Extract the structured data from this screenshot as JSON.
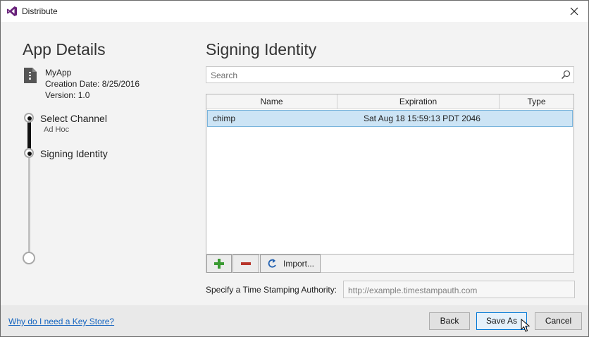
{
  "window": {
    "title": "Distribute",
    "app_icon": "visual-studio-icon",
    "close_icon": "close-icon"
  },
  "left": {
    "section_title": "App Details",
    "app_name": "MyApp",
    "creation_date": "Creation Date: 8/25/2016",
    "version": "Version: 1.0",
    "steps": [
      {
        "label": "Select Channel",
        "sublabel": "Ad Hoc"
      },
      {
        "label": "Signing Identity",
        "sublabel": ""
      }
    ]
  },
  "right": {
    "section_title": "Signing Identity",
    "search": {
      "placeholder": "Search",
      "value": "",
      "icon": "search-icon"
    },
    "table": {
      "columns": [
        "Name",
        "Expiration",
        "Type"
      ],
      "rows": [
        {
          "name": "chimp",
          "expiration": "Sat Aug 18 15:59:13 PDT 2046",
          "type": "",
          "selected": true
        }
      ]
    },
    "toolbar": {
      "add_icon": "plus-icon",
      "remove_icon": "minus-icon",
      "import_label": "Import...",
      "import_icon": "import-icon"
    },
    "tsa": {
      "label": "Specify a Time Stamping Authority:",
      "placeholder": "http://example.timestampauth.com",
      "value": ""
    }
  },
  "footer": {
    "help_link": "Why do I need a Key Store?",
    "back_label": "Back",
    "save_as_label": "Save As",
    "cancel_label": "Cancel"
  },
  "colors": {
    "accent": "#0078d7",
    "selection": "#cce4f5",
    "link": "#1565c0",
    "add_green": "#3a9a32",
    "remove_red": "#b8352a"
  }
}
